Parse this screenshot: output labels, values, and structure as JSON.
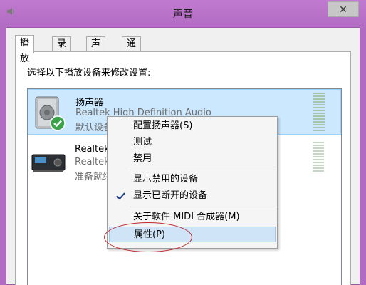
{
  "window": {
    "title": "声音",
    "close_label": "✕"
  },
  "tabs": [
    {
      "label": "播放",
      "active": true
    },
    {
      "label": "录制",
      "active": false
    },
    {
      "label": "声音",
      "active": false
    },
    {
      "label": "通信",
      "active": false
    }
  ],
  "playback": {
    "instruction": "选择以下播放设备来修改设置:",
    "devices": [
      {
        "name": "扬声器",
        "description": "Realtek High Definition Audio",
        "status": "默认设备",
        "icon": "speaker-icon",
        "default": true
      },
      {
        "name": "Realtek",
        "description": "Realtek",
        "status": "准备就绪",
        "icon": "digital-output-icon",
        "default": false
      }
    ]
  },
  "context_menu": {
    "items": [
      {
        "label": "配置扬声器(S)"
      },
      {
        "label": "测试"
      },
      {
        "label": "禁用"
      },
      {
        "label": "显示禁用的设备"
      },
      {
        "label": "显示已断开的设备",
        "checked": true
      },
      {
        "label": "关于软件 MIDI 合成器(M)"
      },
      {
        "label": "属性(P)",
        "highlighted": true
      }
    ]
  },
  "colors": {
    "title_bar": "#b16bc2",
    "selection": "#cce8ff",
    "menu_highlight": "#d0e4f7",
    "annotation": "#c0272d"
  }
}
